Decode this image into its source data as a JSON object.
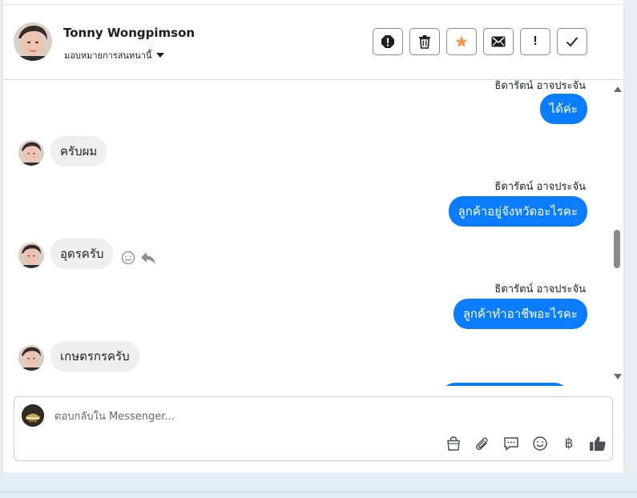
{
  "header": {
    "user_name": "Tonny Wongpimson",
    "assign_label": "มอบหมายการสนทนานี้",
    "actions": [
      {
        "name": "report-button",
        "icon": "alert-circle-icon"
      },
      {
        "name": "delete-button",
        "icon": "trash-icon"
      },
      {
        "name": "star-button",
        "icon": "star-icon"
      },
      {
        "name": "mark-unread-button",
        "icon": "envelope-icon"
      },
      {
        "name": "important-button",
        "icon": "exclamation-icon",
        "text": "!"
      },
      {
        "name": "done-button",
        "icon": "check-icon"
      }
    ],
    "star_color": "#f2994a"
  },
  "messages": [
    {
      "direction": "out",
      "sender": "ธิดารัตน์ อาจประจัน",
      "text": "ได้ค่ะ"
    },
    {
      "direction": "in",
      "text": "ครับผม"
    },
    {
      "direction": "out",
      "sender": "ธิดารัตน์ อาจประจัน",
      "text": "ลูกค้าอยู่จังหวัดอะไรคะ"
    },
    {
      "direction": "in",
      "text": "อุดรครับ"
    },
    {
      "direction": "out",
      "sender": "ธิดารัตน์ อาจประจัน",
      "text": "ลูกค้าทำอาชีพอะไรคะ"
    },
    {
      "direction": "in",
      "text": "เกษตรกรครับ"
    }
  ],
  "composer": {
    "placeholder": "ตอบกลับใน Messenger...",
    "tools": [
      "bag-icon",
      "paperclip-icon",
      "speech-bubble-icon",
      "smiley-icon",
      "baht-icon",
      "thumbs-up-icon"
    ],
    "baht_symbol": "฿"
  },
  "colors": {
    "outgoing_bubble": "#0a7cff",
    "incoming_bubble": "#efefef"
  }
}
